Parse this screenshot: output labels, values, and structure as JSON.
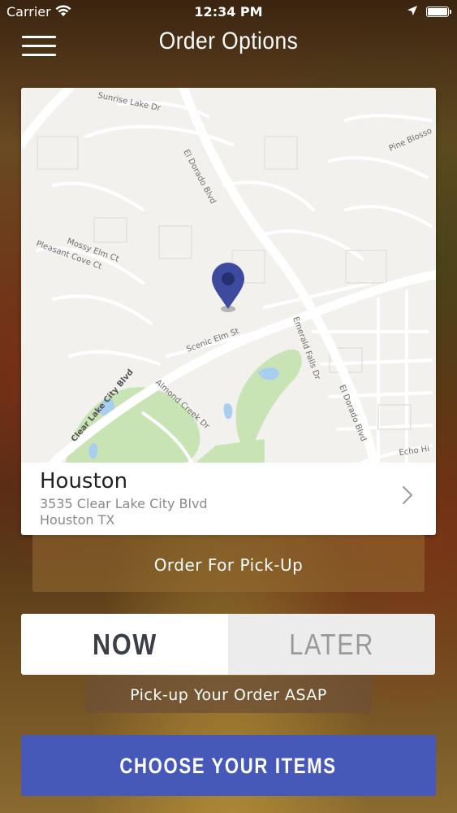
{
  "status_bar": {
    "carrier": "Carrier",
    "time": "12:34 PM",
    "wifi_icon": "wifi-icon",
    "location_icon": "location-arrow-icon",
    "battery_icon": "battery-icon"
  },
  "nav": {
    "title": "Order Options",
    "menu_icon": "hamburger-menu-icon"
  },
  "map": {
    "streets": [
      "Sunrise Lake Dr",
      "Pine Blosso",
      "El Dorado Blvd",
      "Mossy Elm Ct",
      "Pleasant Cove Ct",
      "Scenic Elm St",
      "Emerald Falls Dr",
      "Clear Lake City Blvd",
      "Almond Creek Dr",
      "El Dorado Blvd",
      "Echo Hi"
    ],
    "pin_icon": "map-pin-icon",
    "pin_color": "#3d4a9e"
  },
  "location": {
    "name": "Houston",
    "address_line1": "3535 Clear Lake City Blvd",
    "address_line2": "Houston TX",
    "chevron_icon": "chevron-right-icon"
  },
  "order_type": {
    "label": "Order For Pick-Up"
  },
  "time_toggle": {
    "now_label": "NOW",
    "later_label": "LATER",
    "selected": "NOW"
  },
  "time_hint": "Pick-up Your Order ASAP",
  "cta": {
    "label": "CHOOSE YOUR ITEMS",
    "color": "#4659b9"
  }
}
